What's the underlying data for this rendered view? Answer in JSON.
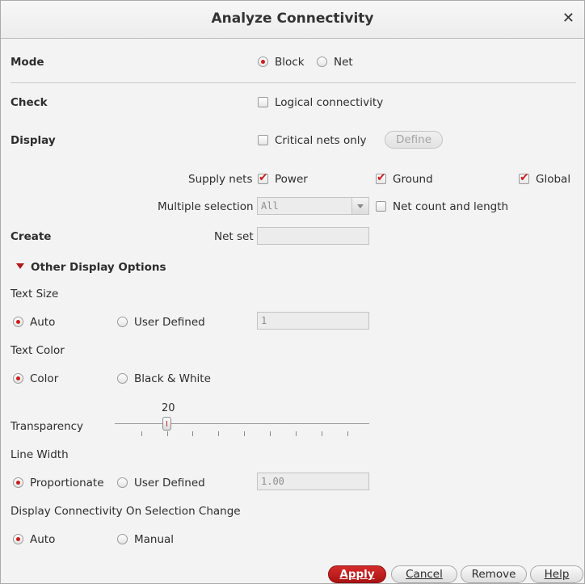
{
  "dialog": {
    "title": "Analyze Connectivity"
  },
  "mode": {
    "label": "Mode",
    "options": [
      "Block",
      "Net"
    ],
    "selected": "Block"
  },
  "check": {
    "label": "Check",
    "logical_connectivity": {
      "label": "Logical connectivity",
      "checked": false
    }
  },
  "display": {
    "label": "Display",
    "critical_nets_only": {
      "label": "Critical nets only",
      "checked": false
    },
    "define_button": "Define",
    "supply_nets": {
      "label": "Supply nets",
      "power": {
        "label": "Power",
        "checked": true
      },
      "ground": {
        "label": "Ground",
        "checked": true
      },
      "global": {
        "label": "Global",
        "checked": true
      }
    },
    "multiple_selection": {
      "label": "Multiple selection",
      "value": "All"
    },
    "net_count_and_length": {
      "label": "Net count and length",
      "checked": false
    }
  },
  "create": {
    "label": "Create",
    "net_set": {
      "label": "Net set",
      "value": ""
    }
  },
  "other_options": {
    "header": "Other Display Options",
    "text_size": {
      "label": "Text Size",
      "auto": "Auto",
      "user_defined": "User Defined",
      "selected": "Auto",
      "value": "1"
    },
    "text_color": {
      "label": "Text Color",
      "color": "Color",
      "bw": "Black & White",
      "selected": "Color"
    },
    "transparency": {
      "label": "Transparency",
      "value": "20",
      "min": 0,
      "max": 100
    },
    "line_width": {
      "label": "Line Width",
      "proportionate": "Proportionate",
      "user_defined": "User Defined",
      "selected": "Proportionate",
      "value": "1.00"
    },
    "selection_change": {
      "label": "Display Connectivity On Selection Change",
      "auto": "Auto",
      "manual": "Manual",
      "selected": "Auto"
    }
  },
  "buttons": {
    "apply": "Apply",
    "cancel": "Cancel",
    "remove": "Remove",
    "help": "Help"
  },
  "colors": {
    "accent": "#cc1e1e",
    "apply_bg": "#b81c1c"
  },
  "icons": {
    "close": "close-icon",
    "expand": "triangle-down-icon",
    "combo": "chevron-down-icon"
  }
}
